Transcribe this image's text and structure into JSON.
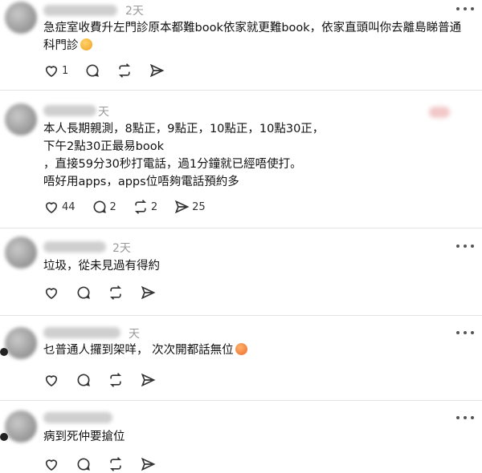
{
  "posts": [
    {
      "time": "2天",
      "text": "急症室收費升左門診原本都難book依家就更難book，依家直頭叫你去離島睇普通科門診",
      "emoji": "sweat-smile-emoji",
      "actions": {
        "like": "1",
        "comment": "",
        "repost": "",
        "share": ""
      }
    },
    {
      "time": "天",
      "text": "本人長期親測，8點正，9點正，10點正，10點30正，\n下午2點30正最易book\n，直接59分30秒打電話，過1分鐘就已經唔使打。\n唔好用apps，apps位唔夠電話預約多",
      "actions": {
        "like": "44",
        "comment": "2",
        "repost": "2",
        "share": "25"
      }
    },
    {
      "time": "2天",
      "text": "垃圾，從未見過有得約",
      "actions": {
        "like": "",
        "comment": "",
        "repost": "",
        "share": ""
      }
    },
    {
      "time": "天",
      "text": "乜普通人攞到架咩， 次次開都話無位",
      "emoji": "tired-face-emoji",
      "actions": {
        "like": "",
        "comment": "",
        "repost": "",
        "share": ""
      }
    },
    {
      "time": "",
      "text": "病到死仲要搶位",
      "actions": {
        "like": "",
        "comment": "",
        "repost": "",
        "share": ""
      }
    }
  ],
  "icons": {
    "like": "heart-icon",
    "comment": "comment-bubble-icon",
    "repost": "repost-icon",
    "share": "send-icon",
    "more": "more-dots-icon"
  },
  "colors": {
    "text": "#111111",
    "muted": "#9a9a9a",
    "divider": "#e3e3e3"
  }
}
